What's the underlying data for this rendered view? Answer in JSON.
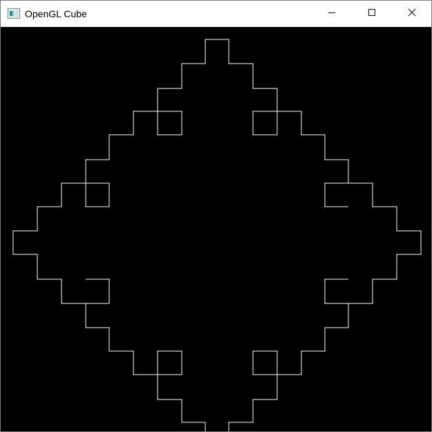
{
  "window": {
    "title": "OpenGL Cube",
    "icon": "opengl-app-icon",
    "controls": {
      "minimize": "minimize-icon",
      "maximize": "maximize-icon",
      "close": "close-icon"
    }
  },
  "canvas": {
    "background": "#000000",
    "line_color": "#ffffff",
    "shape": "koch-quadratic-fractal-outline"
  }
}
